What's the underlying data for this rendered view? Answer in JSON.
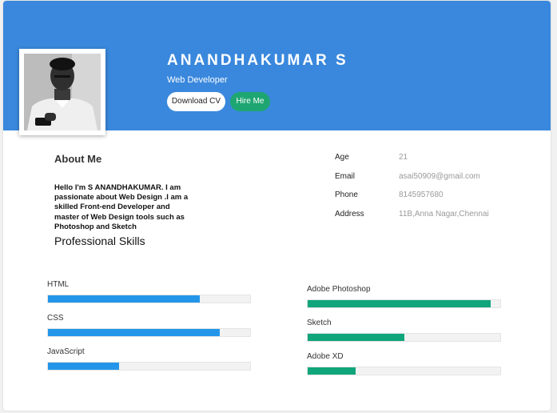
{
  "profile": {
    "name": "ANANDHAKUMAR S",
    "role": "Web Developer",
    "download_cv": "Download CV",
    "hire_me": "Hire Me",
    "photo_icon": "person-photo"
  },
  "about": {
    "title": "About Me",
    "lines": [
      "Hello I'm S ANANDHAKUMAR. I am",
      "passionate about Web Design .I am a",
      "skilled Front-end Developer and",
      "master of Web Design tools such as",
      "Photoshop and Sketch"
    ]
  },
  "info": [
    {
      "label": "Age",
      "value": "21"
    },
    {
      "label": "Email",
      "value": "asai50909@gmail.com"
    },
    {
      "label": "Phone",
      "value": "8145957680"
    },
    {
      "label": "Address",
      "value": "11B,Anna Nagar,Chennai"
    }
  ],
  "skills_title": "Professional Skills",
  "skills_left": [
    {
      "name": "HTML",
      "level": 75
    },
    {
      "name": "CSS",
      "level": 85
    },
    {
      "name": "JavaScript",
      "level": 35
    }
  ],
  "skills_right": [
    {
      "name": "Adobe Photoshop",
      "level": 95
    },
    {
      "name": "Sketch",
      "level": 50
    },
    {
      "name": "Adobe XD",
      "level": 25
    }
  ],
  "colors": {
    "header": "#3a88dd",
    "hire_button": "#1ea672",
    "skill_blue": "#2496ea",
    "skill_green": "#10a57b"
  }
}
